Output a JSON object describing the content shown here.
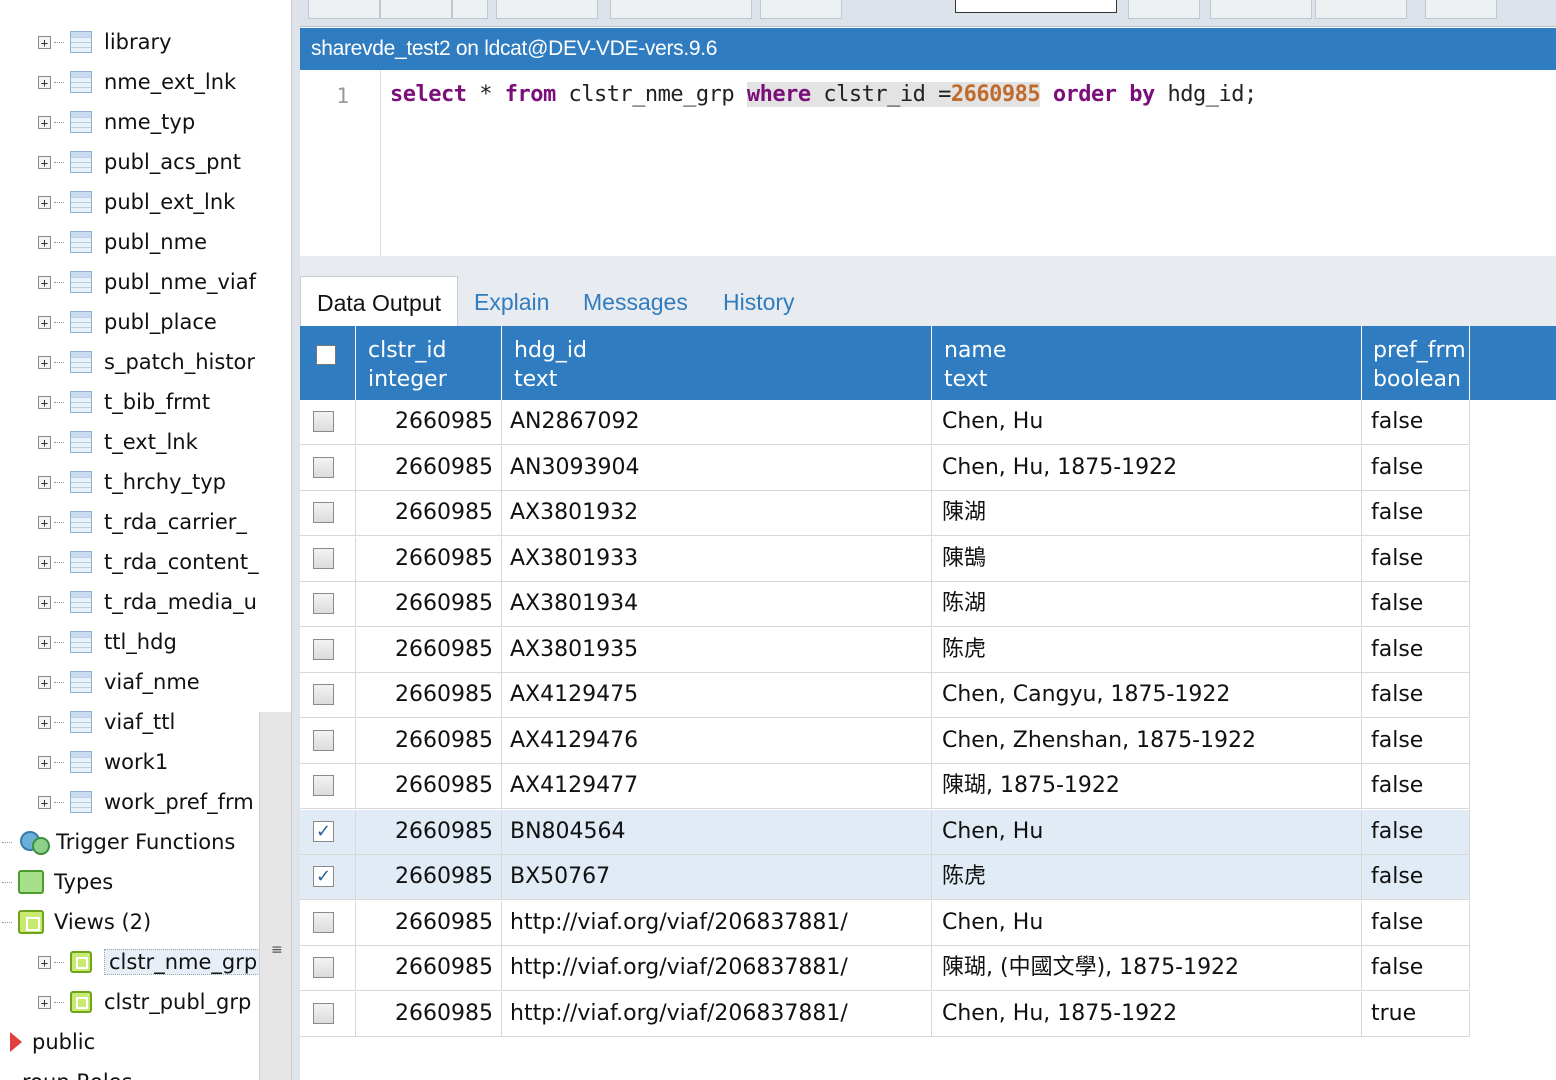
{
  "tree": {
    "tables": [
      "library",
      "nme_ext_lnk",
      "nme_typ",
      "publ_acs_pnt",
      "publ_ext_lnk",
      "publ_nme",
      "publ_nme_viaf",
      "publ_place",
      "s_patch_histor",
      "t_bib_frmt",
      "t_ext_lnk",
      "t_hrchy_typ",
      "t_rda_carrier_",
      "t_rda_content_",
      "t_rda_media_u",
      "ttl_hdg",
      "viaf_nme",
      "viaf_ttl",
      "work1",
      "work_pref_frm"
    ],
    "trigger_functions": "Trigger Functions",
    "types": "Types",
    "views": "Views (2)",
    "view_items": [
      "clstr_nme_grp",
      "clstr_publ_grp"
    ],
    "schema_public": "public",
    "partial_bottom": "roup Roles"
  },
  "editor": {
    "title": "sharevde_test2 on ldcat@DEV-VDE-vers.9.6",
    "line_number": "1",
    "sql": {
      "kw_select": "select",
      "star": " * ",
      "kw_from": "from",
      "table": " clstr_nme_grp ",
      "kw_where": "where",
      "cond": " clstr_id =",
      "value": "2660985",
      "space": " ",
      "kw_order_by": "order by",
      "tail": " hdg_id;"
    }
  },
  "tabs": [
    "Data Output",
    "Explain",
    "Messages",
    "History"
  ],
  "grid": {
    "columns": [
      {
        "name": "clstr_id",
        "type": "integer"
      },
      {
        "name": "hdg_id",
        "type": "text"
      },
      {
        "name": "name",
        "type": "text"
      },
      {
        "name": "pref_frm",
        "type": "boolean"
      }
    ],
    "rows": [
      {
        "checked": false,
        "clstr_id": "2660985",
        "hdg_id": "AN2867092",
        "name": "Chen, Hu",
        "pref_frm": "false"
      },
      {
        "checked": false,
        "clstr_id": "2660985",
        "hdg_id": "AN3093904",
        "name": "Chen, Hu, 1875-1922",
        "pref_frm": "false"
      },
      {
        "checked": false,
        "clstr_id": "2660985",
        "hdg_id": "AX3801932",
        "name": "陳湖",
        "pref_frm": "false"
      },
      {
        "checked": false,
        "clstr_id": "2660985",
        "hdg_id": "AX3801933",
        "name": "陳鵠",
        "pref_frm": "false"
      },
      {
        "checked": false,
        "clstr_id": "2660985",
        "hdg_id": "AX3801934",
        "name": "陈湖",
        "pref_frm": "false"
      },
      {
        "checked": false,
        "clstr_id": "2660985",
        "hdg_id": "AX3801935",
        "name": "陈虎",
        "pref_frm": "false"
      },
      {
        "checked": false,
        "clstr_id": "2660985",
        "hdg_id": "AX4129475",
        "name": "Chen, Cangyu, 1875-1922",
        "pref_frm": "false"
      },
      {
        "checked": false,
        "clstr_id": "2660985",
        "hdg_id": "AX4129476",
        "name": "Chen, Zhenshan, 1875-1922",
        "pref_frm": "false"
      },
      {
        "checked": false,
        "clstr_id": "2660985",
        "hdg_id": "AX4129477",
        "name": "陳瑚, 1875-1922",
        "pref_frm": "false"
      },
      {
        "checked": true,
        "clstr_id": "2660985",
        "hdg_id": "BN804564",
        "name": "Chen, Hu",
        "pref_frm": "false"
      },
      {
        "checked": true,
        "clstr_id": "2660985",
        "hdg_id": "BX50767",
        "name": "陈虎",
        "pref_frm": "false"
      },
      {
        "checked": false,
        "clstr_id": "2660985",
        "hdg_id": "http://viaf.org/viaf/206837881/",
        "name": "Chen, Hu",
        "pref_frm": "false"
      },
      {
        "checked": false,
        "clstr_id": "2660985",
        "hdg_id": "http://viaf.org/viaf/206837881/",
        "name": "陳瑚, (中國文學), 1875-1922",
        "pref_frm": "false"
      },
      {
        "checked": false,
        "clstr_id": "2660985",
        "hdg_id": "http://viaf.org/viaf/206837881/",
        "name": "Chen, Hu, 1875-1922",
        "pref_frm": "true"
      }
    ]
  },
  "colors": {
    "accent": "#2f7cc0",
    "keyword": "#7a0e7a",
    "number": "#c06a2c",
    "selected_row": "#e0ebf5"
  }
}
